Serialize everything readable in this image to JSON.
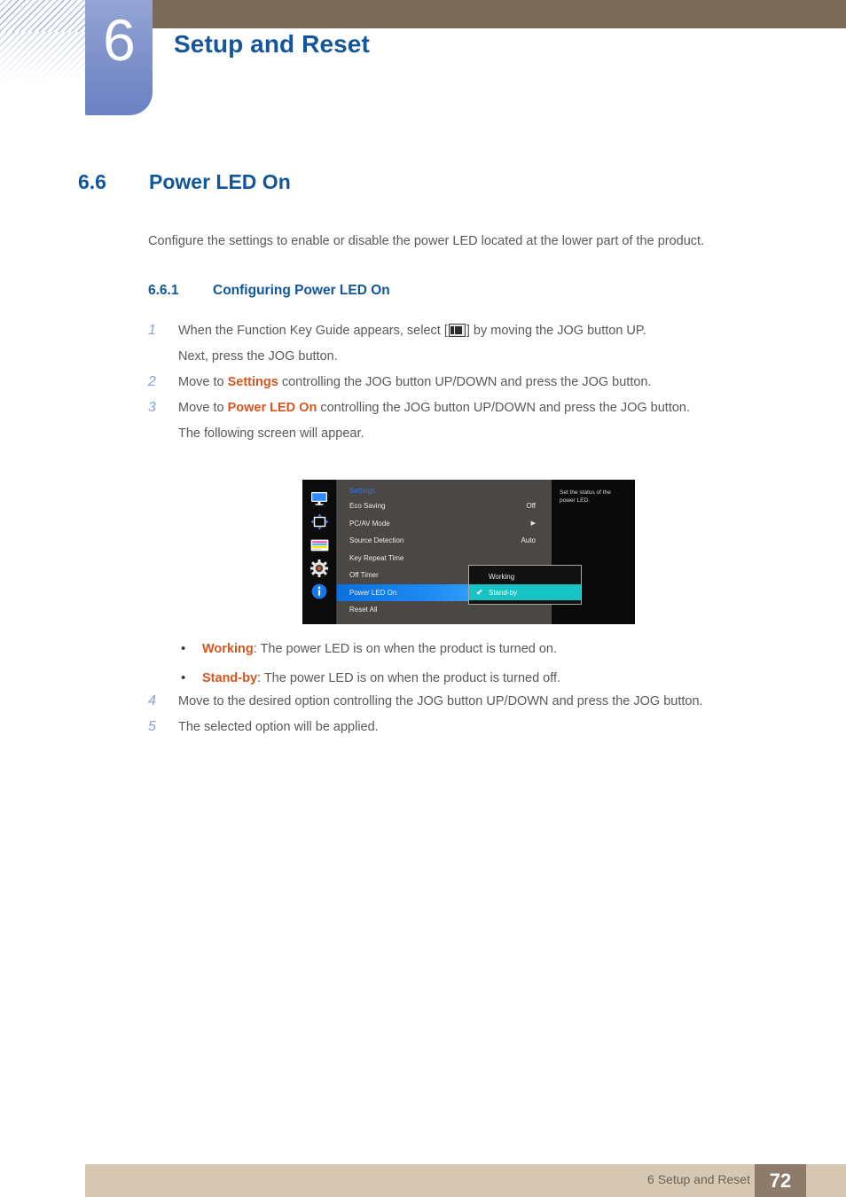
{
  "header": {
    "chapter_number": "6",
    "chapter_title": "Setup and Reset",
    "accent_blue": "#14559e",
    "tab_blue": "#8093cb",
    "bar_brown": "#7a6a57"
  },
  "section": {
    "number": "6.6",
    "title": "Power LED On",
    "intro": "Configure the settings to enable or disable the power LED located at the lower part of the product.",
    "sub_number": "6.6.1",
    "sub_title": "Configuring Power LED On"
  },
  "steps": [
    {
      "num": "1",
      "pre": "When the Function Key Guide appears, select [",
      "icon": "function-key-guide-icon",
      "post": "] by moving the JOG button UP.",
      "second_line": "Next, press the JOG button."
    },
    {
      "num": "2",
      "pre": "Move to ",
      "keyword": "Settings",
      "post": " controlling the JOG button UP/DOWN and press the JOG button."
    },
    {
      "num": "3",
      "pre": "Move to ",
      "keyword": "Power LED On",
      "post": " controlling the JOG button UP/DOWN and press the JOG button.",
      "second_line": "The following screen will appear."
    }
  ],
  "bullets": [
    {
      "dot": "•",
      "keyword": "Working",
      "text": ": The power LED is on when the product is turned on."
    },
    {
      "dot": "•",
      "keyword": "Stand-by",
      "text": ": The power LED is on when the product is turned off."
    }
  ],
  "steps2": [
    {
      "num": "4",
      "text": "Move to the desired option controlling the JOG button UP/DOWN and press the JOG button."
    },
    {
      "num": "5",
      "text": "The selected option will be applied."
    }
  ],
  "osd": {
    "title": "Settings",
    "icons": [
      "monitor-icon",
      "screen-adjust-icon",
      "color-bars-icon",
      "gear-icon",
      "info-icon"
    ],
    "rows": [
      {
        "label": "Eco Saving",
        "value": "Off",
        "type": "value",
        "selected": false
      },
      {
        "label": "PC/AV Mode",
        "value": "▶",
        "type": "arrow",
        "selected": false
      },
      {
        "label": "Source Detection",
        "value": "Auto",
        "type": "value",
        "selected": false
      },
      {
        "label": "Key Repeat Time",
        "value": "",
        "type": "plain",
        "selected": false
      },
      {
        "label": "Off Timer",
        "value": "",
        "type": "plain",
        "selected": false
      },
      {
        "label": "Power LED On",
        "value": "",
        "type": "plain",
        "selected": true
      },
      {
        "label": "Reset All",
        "value": "",
        "type": "plain",
        "selected": false
      }
    ],
    "dropdown": [
      {
        "label": "Working",
        "checked": false
      },
      {
        "label": "Stand-by",
        "checked": true,
        "check": "✔"
      }
    ],
    "info_text": "Set the status of the power LED.",
    "highlight_blue": "#1e8bf5",
    "dropdown_teal": "#17c4c4",
    "title_blue": "#2f7bf0"
  },
  "footer": {
    "text": "6 Setup and Reset",
    "page": "72",
    "bar_color": "#d6c8b2",
    "page_box_color": "#8e7b6b"
  }
}
